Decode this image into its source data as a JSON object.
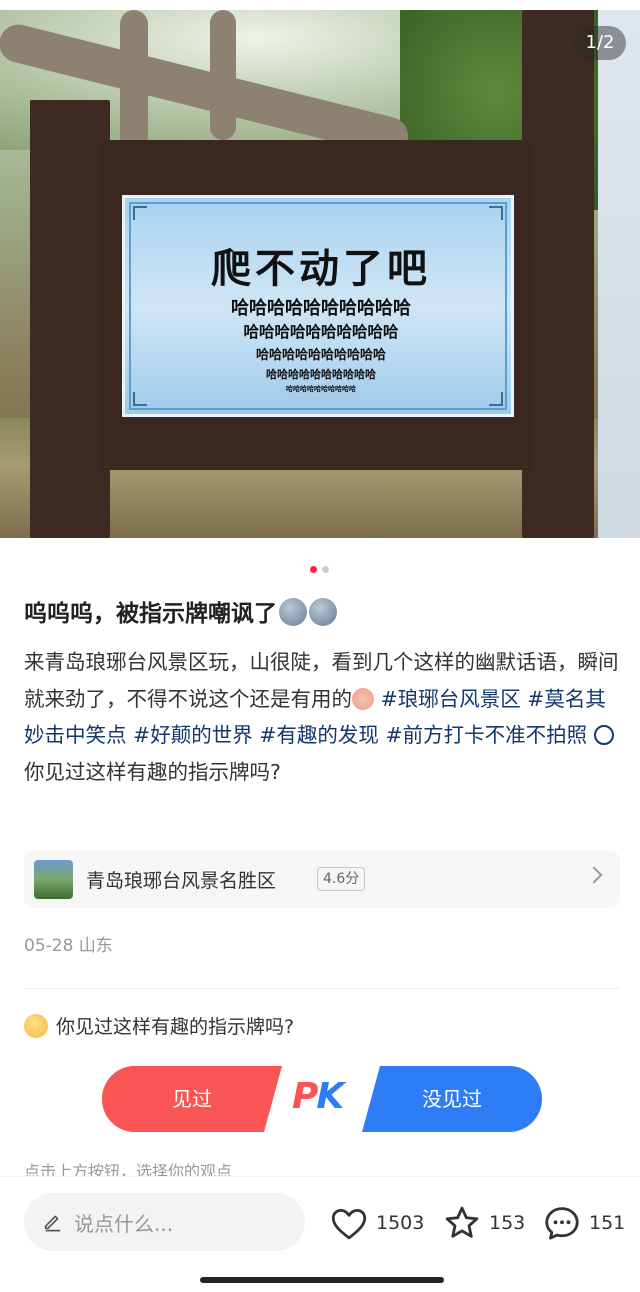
{
  "photo": {
    "counter": "1/2",
    "sign_title": "爬不动了吧",
    "sign_lines": [
      "哈哈哈哈哈哈哈哈哈哈",
      "哈哈哈哈哈哈哈哈哈哈",
      "哈哈哈哈哈哈哈哈哈哈",
      "哈哈哈哈哈哈哈哈哈哈",
      "哈哈哈哈哈哈哈哈哈哈"
    ]
  },
  "carousel": {
    "total": 2,
    "active": 1
  },
  "post": {
    "title": "呜呜呜，被指示牌嘲讽了",
    "body_1": "来青岛琅琊台风景区玩，山很陡，看到几个这样的幽默话语，瞬间就来劲了，不得不说这个还是有用的",
    "tag_1": "#琅琊台风景区",
    "tag_2": "#莫名其妙击中笑点",
    "tag_3": "#好颠的世界",
    "tag_4": "#有趣的发现",
    "tag_5": "#前方打卡不准不拍照",
    "body_2": "你见过这样有趣的指示牌吗?"
  },
  "location": {
    "name": "青岛琅琊台风景名胜区",
    "score": "4.6分"
  },
  "meta": {
    "date_place": "05-28 山东"
  },
  "poll": {
    "question": "你见过这样有趣的指示牌吗?",
    "option_left": "见过",
    "option_right": "没见过",
    "pk_p": "P",
    "pk_k": "K",
    "hint": "点击上方按钮，选择你的观点"
  },
  "bottom": {
    "comment_placeholder": "说点什么...",
    "likes": "1503",
    "stars": "153",
    "comments": "151"
  },
  "colors": {
    "accent": "#ff2442",
    "tag": "#13386c",
    "pk_red": "#fa5555",
    "pk_blue": "#2f7df6"
  },
  "icons": [
    "heart-icon",
    "star-icon",
    "comment-icon",
    "pencil-icon",
    "chevron-right-icon"
  ]
}
